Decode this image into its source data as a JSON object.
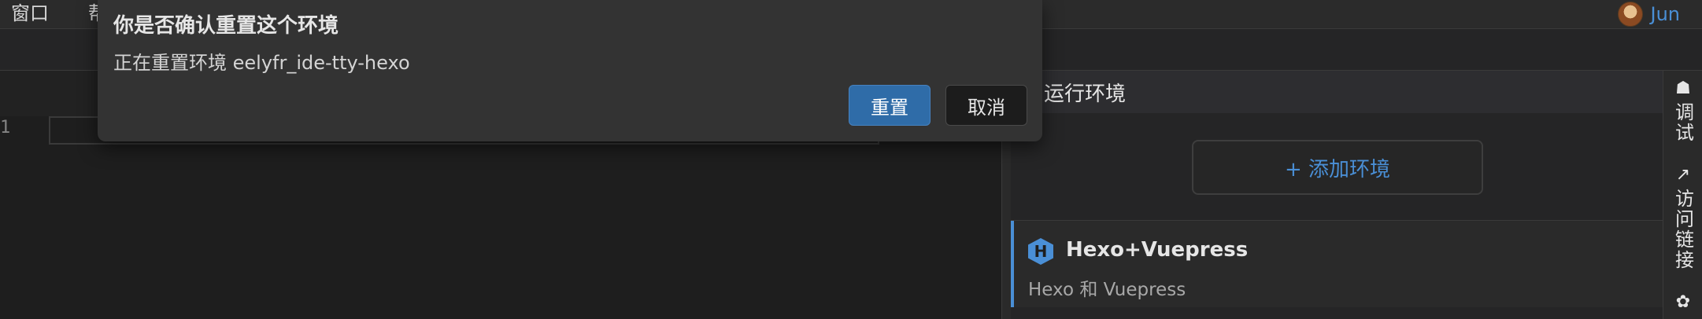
{
  "menubar": {
    "items": [
      "窗口",
      "帮"
    ]
  },
  "user": {
    "name": "Jun"
  },
  "editor": {
    "line_number": "1"
  },
  "right_panel": {
    "header": "运行环境",
    "add_button": "+ 添加环境",
    "environments": [
      {
        "name": "Hexo+Vuepress",
        "description": "Hexo 和 Vuepress",
        "badge": "H"
      }
    ]
  },
  "activity_bar": {
    "items": [
      {
        "label": "调试",
        "icon": "debug-icon"
      },
      {
        "label": "访问链接",
        "icon": "external-link-icon"
      },
      {
        "label": "",
        "icon": "cluster-icon"
      }
    ]
  },
  "dialog": {
    "title": "你是否确认重置这个环境",
    "message": "正在重置环境 eelyfr_ide-tty-hexo",
    "confirm_label": "重置",
    "cancel_label": "取消"
  },
  "colors": {
    "accent": "#4a8fd6",
    "primary_button": "#2f6ca8",
    "dialog_bg": "#333333"
  }
}
